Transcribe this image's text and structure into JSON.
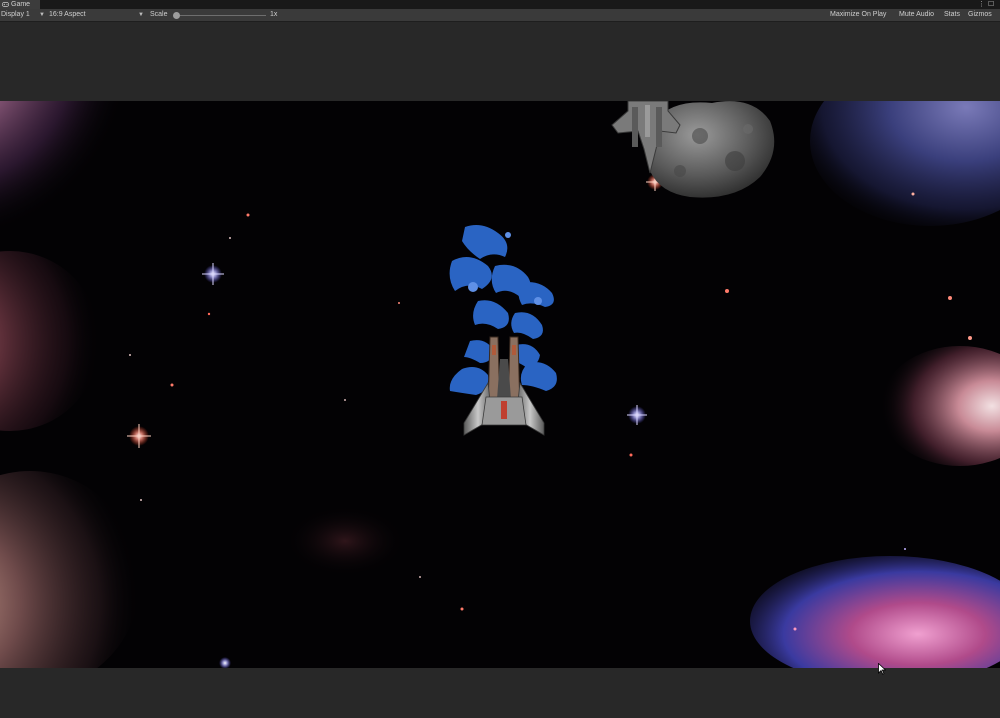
{
  "tab": {
    "title": "Game",
    "icon": "gamepad-icon"
  },
  "window_controls": {
    "more": "⋮",
    "maximize": "☐"
  },
  "toolbar": {
    "display": "Display 1",
    "aspect": "16:9 Aspect",
    "scale_label": "Scale",
    "scale_value": "1x",
    "maximize_on_play": "Maximize On Play",
    "mute_audio": "Mute Audio",
    "stats": "Stats",
    "gizmos": "Gizmos"
  },
  "scene": {
    "player": "player-spaceship",
    "effect": "blue-plasma-exhaust",
    "enemy": "enemy-ship",
    "hazard": "asteroid",
    "background": "space-nebula-starfield"
  },
  "colors": {
    "editor_bg": "#282828",
    "toolbar_bg": "#3a3a3a",
    "space": "#030204",
    "plasma": "#2f6fd8"
  }
}
